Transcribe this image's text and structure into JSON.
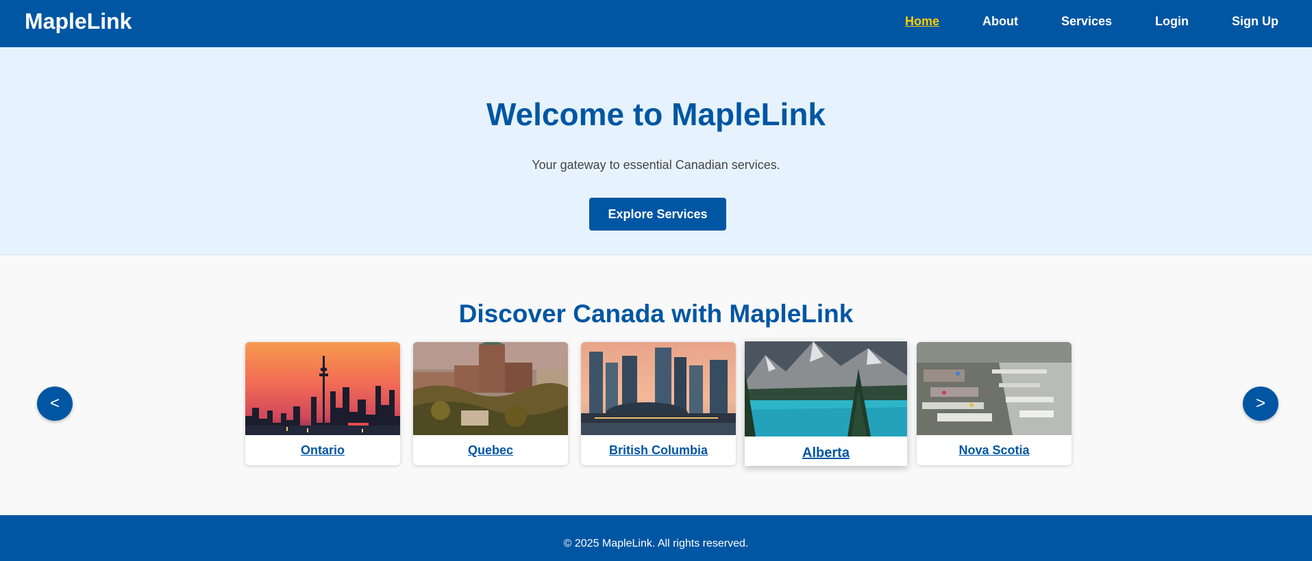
{
  "brand": "MapleLink",
  "nav": {
    "home": "Home",
    "about": "About",
    "services": "Services",
    "login": "Login",
    "signup": "Sign Up"
  },
  "hero": {
    "title": "Welcome to MapleLink",
    "subtitle": "Your gateway to essential Canadian services.",
    "cta": "Explore Services"
  },
  "discover": {
    "title": "Discover Canada with MapleLink",
    "prev": "<",
    "next": ">",
    "provinces": [
      "Ontario",
      "Quebec",
      "British Columbia",
      "Alberta",
      "Nova Scotia"
    ]
  },
  "footer": "© 2025 MapleLink. All rights reserved.",
  "colors": {
    "primary": "#0056a3",
    "active_link": "#ffcc00",
    "hero_bg": "#e6f3fe"
  }
}
